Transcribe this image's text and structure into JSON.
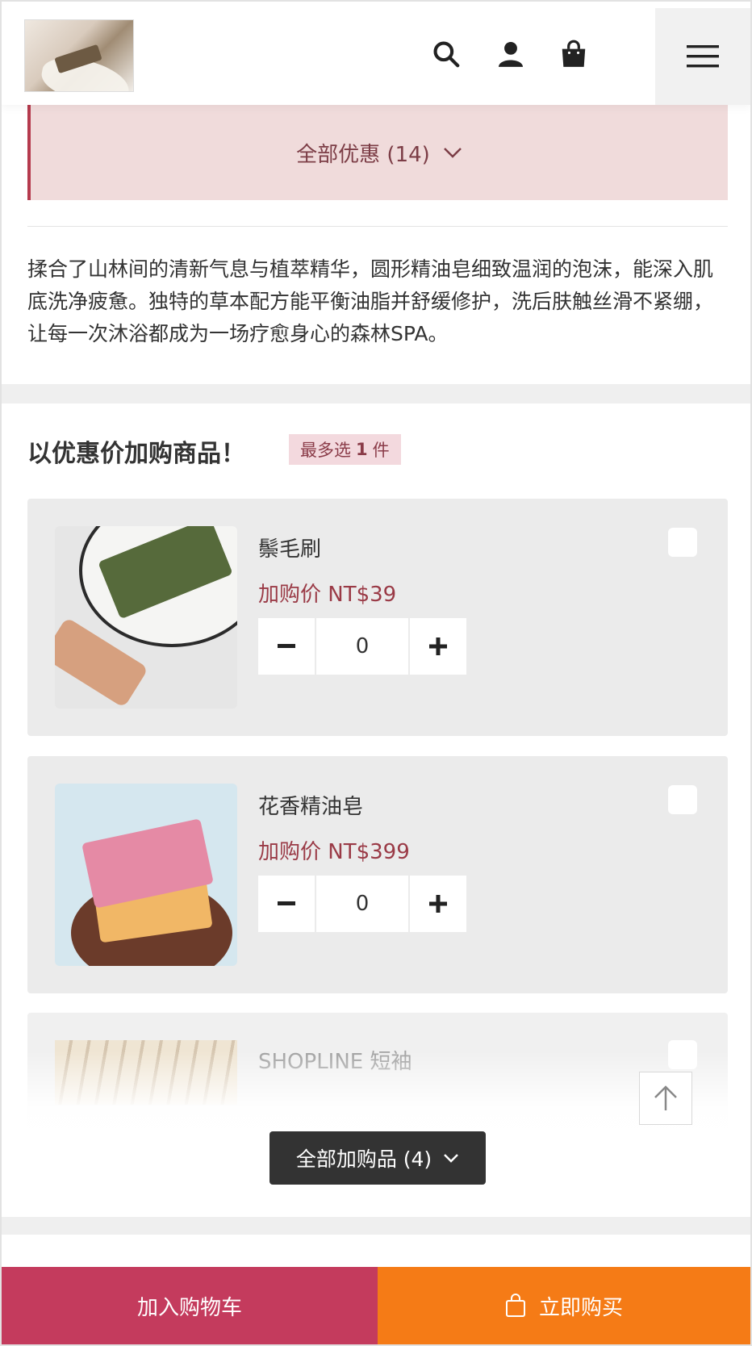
{
  "header": {
    "icons": [
      "search-icon",
      "user-icon",
      "shopping-bag-icon",
      "menu-icon"
    ]
  },
  "promo": {
    "label": "全部优惠 (14)"
  },
  "description": "揉合了山林间的清新气息与植萃精华，圆形精油皂细致温润的泡沫，能深入肌底洗净疲惫。独特的草本配方能平衡油脂并舒缓修护，洗后肤触丝滑不紧绷，让每一次沐浴都成为一场疗愈身心的森林SPA。",
  "addon": {
    "title": "以优惠价加购商品！",
    "badge_prefix": "最多选",
    "badge_count": "1",
    "badge_suffix": "件",
    "items": [
      {
        "name": "鬃毛刷",
        "price": "加购价  NT$39",
        "qty": "0"
      },
      {
        "name": "花香精油皂",
        "price": "加购价  NT$399",
        "qty": "0"
      },
      {
        "name": "SHOPLINE 短袖"
      }
    ],
    "all_button": "全部加购品 (4)"
  },
  "bottom": {
    "add_to_cart": "加入购物车",
    "buy_now": "立即购买"
  },
  "colors": {
    "promo_bg": "#f0dbdb",
    "price": "#9a3a46",
    "cart_button": "#c43b5d",
    "buy_button": "#f57b16"
  }
}
